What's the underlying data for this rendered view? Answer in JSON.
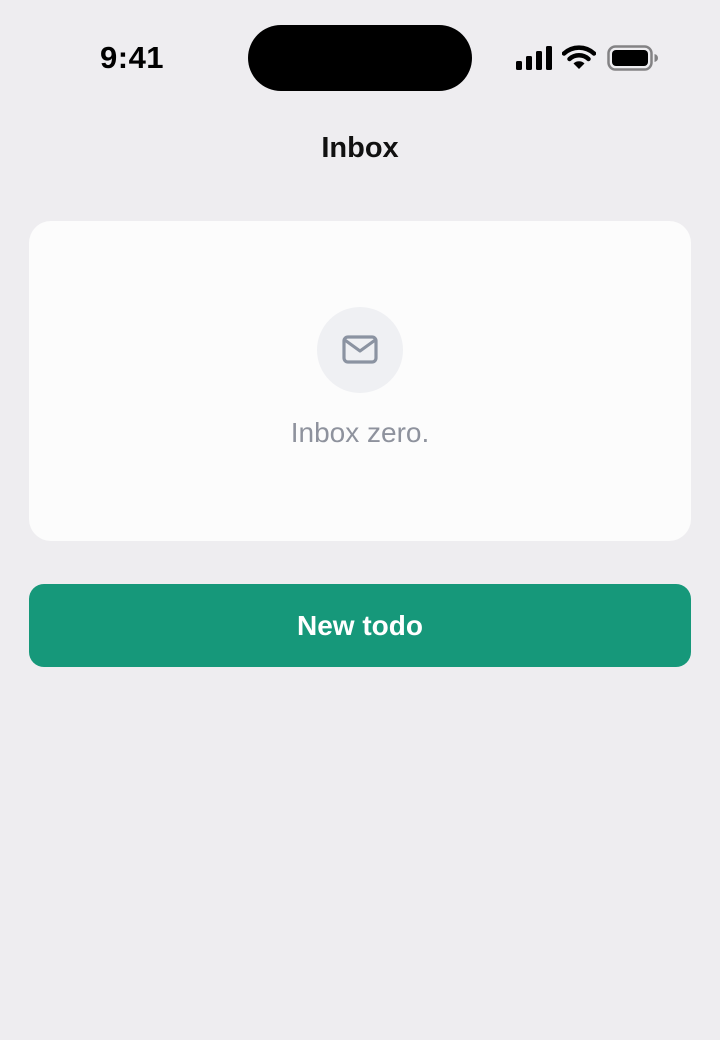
{
  "status_bar": {
    "time": "9:41",
    "icons": [
      "signal-icon",
      "wifi-icon",
      "battery-icon"
    ]
  },
  "nav": {
    "title": "Inbox"
  },
  "empty_state": {
    "icon": "mail-icon",
    "message": "Inbox zero."
  },
  "actions": {
    "new_todo_label": "New todo"
  },
  "colors": {
    "background": "#eeedf0",
    "card": "#fcfcfc",
    "accent": "#16987a",
    "muted_text": "#8e929d"
  }
}
